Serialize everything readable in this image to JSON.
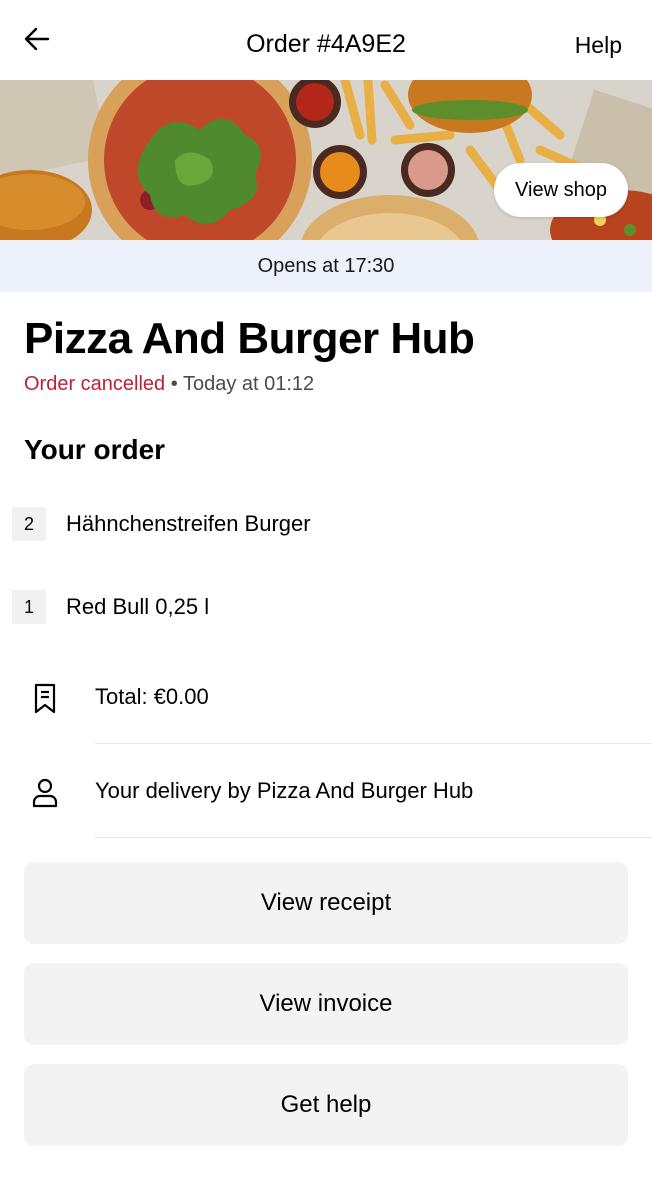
{
  "header": {
    "title": "Order #4A9E2",
    "help_label": "Help",
    "back_icon": "arrow-left-icon"
  },
  "hero": {
    "view_shop_label": "View shop"
  },
  "banner": {
    "opens_text": "Opens at 17:30",
    "background_color": "#edf1fb"
  },
  "store": {
    "name": "Pizza And Burger Hub",
    "status": "Order cancelled",
    "status_separator": " • ",
    "time": "Today at 01:12",
    "status_color": "#c01f3a"
  },
  "order": {
    "section_title": "Your order",
    "items": [
      {
        "qty": "2",
        "name": "Hähnchenstreifen Burger"
      },
      {
        "qty": "1",
        "name": "Red Bull 0,25 l"
      }
    ]
  },
  "details": {
    "total": {
      "icon": "receipt-icon",
      "text": "Total: €0.00"
    },
    "delivery": {
      "icon": "person-icon",
      "text": "Your delivery by Pizza And Burger Hub"
    }
  },
  "actions": {
    "view_receipt": "View receipt",
    "view_invoice": "View invoice",
    "get_help": "Get help"
  }
}
